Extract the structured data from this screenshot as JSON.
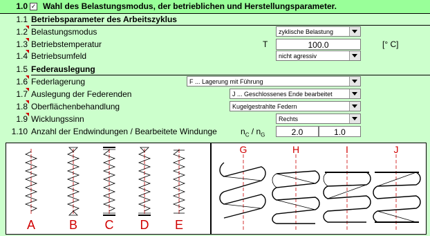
{
  "header": {
    "number": "1.0",
    "title": "Wahl des Belastungsmodus, der betrieblichen und Herstellungsparameter."
  },
  "rows": [
    {
      "num": "1.1",
      "label": "Betriebsparameter des Arbeitszyklus"
    },
    {
      "num": "1.2",
      "label": "Belastungsmodus",
      "value": "zyklische Belastung"
    },
    {
      "num": "1.3",
      "label": "Betriebstemperatur",
      "symbol": "T",
      "value": "100.0",
      "unit": "[° C]"
    },
    {
      "num": "1.4",
      "label": "Betriebsumfeld",
      "value": "nicht agressiv"
    },
    {
      "num": "1.5",
      "label": "Federauslegung"
    },
    {
      "num": "1.6",
      "label": "Federlagerung",
      "value": "F ... Lagerung mit Führung"
    },
    {
      "num": "1.7",
      "label": "Auslegung der Federenden",
      "value": "J ... Geschlossenes Ende bearbeitet"
    },
    {
      "num": "1.8",
      "label": "Oberflächenbehandlung",
      "value": "Kugelgestrahlte Federn"
    },
    {
      "num": "1.9",
      "label": "Wicklungssinn",
      "value": "Rechts"
    },
    {
      "num": "1.10",
      "label": "Anzahl der Endwindungen / Bearbeitete Windunge",
      "symbol_a": "n",
      "sub_a": "C",
      "slash": " / ",
      "symbol_b": "n",
      "sub_b": "G",
      "value1": "2.0",
      "value2": "1.0"
    }
  ],
  "figures": {
    "left_labels": [
      "A",
      "B",
      "C",
      "D",
      "E"
    ],
    "right_labels": [
      "G",
      "H",
      "I",
      "J"
    ]
  },
  "colors": {
    "background": "#ccffcc",
    "header_bg": "#99ff99",
    "accent_red": "#d00000"
  }
}
